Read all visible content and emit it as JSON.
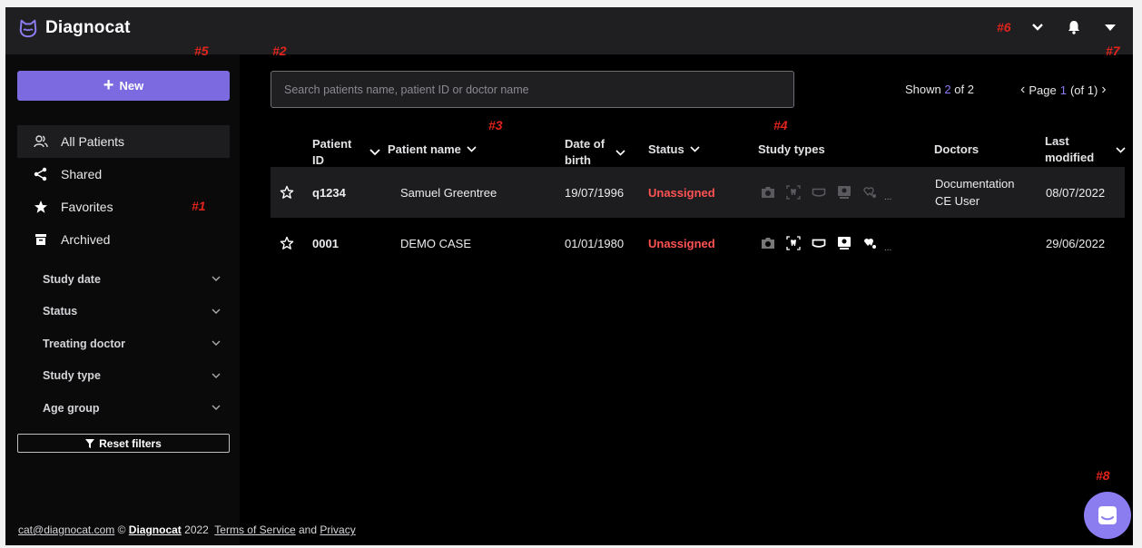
{
  "app": {
    "name": "Diagnocat"
  },
  "markers": {
    "m1": "#1",
    "m2": "#2",
    "m3": "#3",
    "m4": "#4",
    "m5": "#5",
    "m6": "#6",
    "m7": "#7",
    "m8": "#8"
  },
  "sidebar": {
    "new_button": "New",
    "nav": [
      {
        "label": "All Patients",
        "icon": "patients-icon",
        "active": true
      },
      {
        "label": "Shared",
        "icon": "share-icon"
      },
      {
        "label": "Favorites",
        "icon": "star-icon"
      },
      {
        "label": "Archived",
        "icon": "archive-icon"
      }
    ],
    "filters": [
      "Study date",
      "Status",
      "Treating doctor",
      "Study type",
      "Age group"
    ],
    "reset_button": "Reset filters"
  },
  "search": {
    "placeholder": "Search patients name, patient ID or doctor name",
    "value": ""
  },
  "results": {
    "shown_label": "Shown",
    "shown": "2",
    "of_label": "of 2"
  },
  "pager": {
    "label": "Page",
    "page": "1",
    "total_label": "(of 1)"
  },
  "table": {
    "headers": {
      "patient_id": [
        "Patient",
        "ID"
      ],
      "patient_name": "Patient name",
      "dob": [
        "Date of",
        "birth"
      ],
      "status": "Status",
      "study_types": "Study types",
      "doctors": "Doctors",
      "last_modified": [
        "Last",
        "modified"
      ]
    },
    "rows": [
      {
        "id": "q1234",
        "name": "Samuel Greentree",
        "dob": "19/07/1996",
        "status": "Unassigned",
        "doctor": [
          "Documentation",
          "CE User"
        ],
        "modified": "08/07/2022",
        "icons_active": [
          false,
          false,
          true,
          true,
          false
        ]
      },
      {
        "id": "0001",
        "name": "DEMO CASE",
        "dob": "01/01/1980",
        "status": "Unassigned",
        "doctor": [
          "",
          ""
        ],
        "modified": "29/06/2022",
        "icons_active": [
          false,
          true,
          true,
          true,
          true
        ]
      }
    ],
    "more": "..."
  },
  "footer": {
    "email": "cat@diagnocat.com",
    "copyright": "©",
    "brand": "Diagnocat",
    "year": "2022",
    "terms": "Terms of Service",
    "and": "and",
    "privacy": "Privacy"
  },
  "colors": {
    "accent": "#8b7cf0",
    "button": "#7b6ae0",
    "danger": "#ff5252",
    "marker": "#e0241b"
  }
}
